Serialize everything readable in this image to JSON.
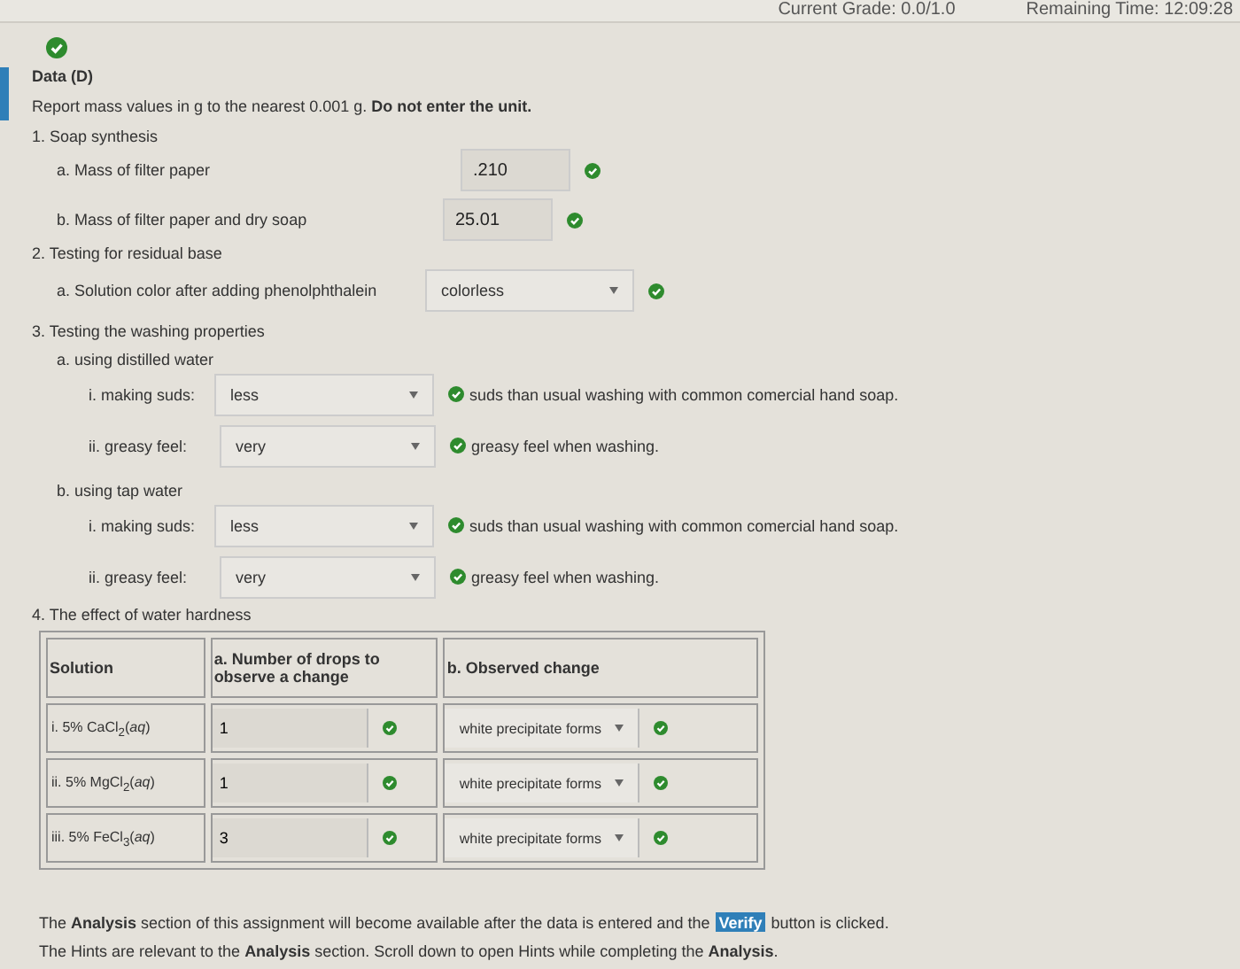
{
  "top_bar": {
    "grade": "Current Grade: 0.0/1.0",
    "time": "Remaining Time: 12:09:28"
  },
  "section_correct": true,
  "title": "Data (D)",
  "instructions": "Report mass values in g to the nearest 0.001 g.  **Do not enter the unit.**",
  "q1": {
    "label": "1. Soap synthesis",
    "fields": [
      {
        "label": "a. Mass of filter paper",
        "value": ".210",
        "correct": true
      },
      {
        "label": "b. Mass of filter paper and dry soap",
        "value": "25.01",
        "correct": true
      }
    ]
  },
  "q2": {
    "label": "2. Testing for residual base",
    "select": {
      "label": "a. Solution color after adding phenolphthalein",
      "value": "colorless",
      "correct": true
    }
  },
  "q3": {
    "label": "3. Testing the washing properties",
    "groups": [
      {
        "label": "a. using distilled water",
        "rows": [
          {
            "label": "i. making suds:",
            "value": "less",
            "correct": true,
            "suffix": "suds than usual washing with common comercial hand soap."
          },
          {
            "label": "ii. greasy feel:",
            "value": "very",
            "correct": true,
            "suffix": "greasy feel when washing."
          }
        ]
      },
      {
        "label": "b. using tap water",
        "rows": [
          {
            "label": "i. making suds:",
            "value": "less",
            "correct": true,
            "suffix": "suds than usual washing with common comercial hand soap."
          },
          {
            "label": "ii. greasy feel:",
            "value": "very",
            "correct": true,
            "suffix": "greasy feel when washing."
          }
        ]
      }
    ]
  },
  "q4": {
    "label": "4. The effect of water hardness",
    "columns": [
      "Solution",
      "a. Number of drops to observe a change",
      "b. Observed change"
    ],
    "rows": [
      {
        "solution": "i. 5% CaCl$_{2}$(*aq*)",
        "drops": "1",
        "drops_correct": true,
        "change": "white precipitate forms",
        "change_correct": true
      },
      {
        "solution": "ii. 5% MgCl$_{2}$(*aq*)",
        "drops": "1",
        "drops_correct": true,
        "change": "white precipitate forms",
        "change_correct": true
      },
      {
        "solution": "iii. 5% FeCl$_{3}$(*aq*)",
        "drops": "3",
        "drops_correct": true,
        "change": "white precipitate forms",
        "change_correct": true
      }
    ]
  },
  "footer": {
    "line1_before": "The **Analysis** section of this assignment will become available after the data is entered and the",
    "verify": "Verify",
    "line1_after": "button is clicked.",
    "line2": "The Hints are relevant to the **Analysis** section.  Scroll down to open Hints while completing the **Analysis**."
  }
}
